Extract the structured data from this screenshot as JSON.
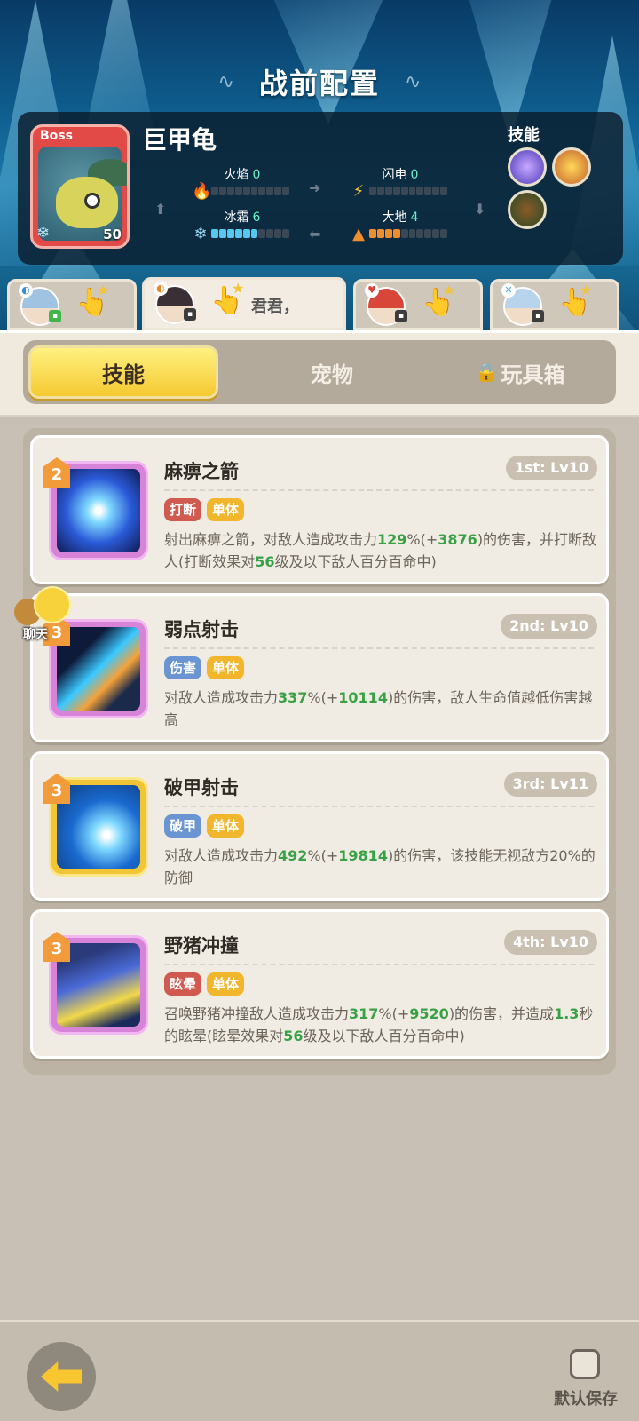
{
  "header": {
    "title": "战前配置"
  },
  "boss": {
    "tag": "Boss",
    "level": "50",
    "name": "巨甲龟",
    "skills_label": "技能",
    "stats": [
      {
        "name": "火焰",
        "value": "0",
        "level": 0,
        "icon": "flame-icon",
        "color": "#e84a3a"
      },
      {
        "name": "闪电",
        "value": "0",
        "level": 0,
        "icon": "lightning-icon",
        "color": "#f4c434"
      },
      {
        "name": "冰霜",
        "value": "6",
        "level": 6,
        "icon": "frost-icon",
        "color": "#56c8f0"
      },
      {
        "name": "大地",
        "value": "4",
        "level": 4,
        "icon": "earth-icon",
        "color": "#f08d2c"
      }
    ]
  },
  "heroes": {
    "active_name": "君君，",
    "active_index": 1
  },
  "tabs": {
    "skills": "技能",
    "pets": "宠物",
    "toybox": "玩具箱"
  },
  "skills": [
    {
      "name": "麻痹之箭",
      "level": "1st: Lv10",
      "badge": "2",
      "tags": [
        "打断",
        "单体"
      ],
      "desc": [
        "射出麻痹之箭，对敌人造成攻击力",
        "129",
        "%(+",
        "3876",
        ")的伤害，并打断敌人(打断效果对",
        "56",
        "级及以下敌人百分百命中)"
      ]
    },
    {
      "name": "弱点射击",
      "level": "2nd: Lv10",
      "badge": "3",
      "tags": [
        "伤害",
        "单体"
      ],
      "desc": [
        "对敌人造成攻击力",
        "337",
        "%(+",
        "10114",
        ")的伤害，敌人生命值越低伤害越高"
      ]
    },
    {
      "name": "破甲射击",
      "level": "3rd: Lv11",
      "badge": "3",
      "tags": [
        "破甲",
        "单体"
      ],
      "desc": [
        "对敌人造成攻击力",
        "492",
        "%(+",
        "19814",
        ")的伤害，该技能无视敌方20%的防御"
      ]
    },
    {
      "name": "野猪冲撞",
      "level": "4th: Lv10",
      "badge": "3",
      "tags": [
        "眩晕",
        "单体"
      ],
      "desc": [
        "召唤野猪冲撞敌人造成攻击力",
        "317",
        "%(+",
        "9520",
        ")的伤害，并造成",
        "1.3",
        "秒的眩晕(眩晕效果对",
        "56",
        "级及以下敌人百分百命中)"
      ]
    }
  ],
  "chat": {
    "label": "聊天"
  },
  "footer": {
    "save_label": "默认保存"
  }
}
